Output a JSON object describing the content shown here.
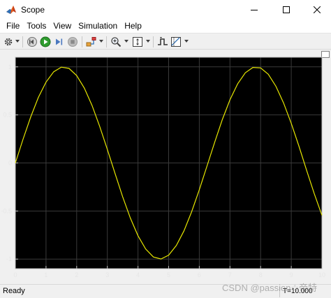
{
  "window": {
    "title": "Scope",
    "controls": [
      "minimize",
      "maximize",
      "close"
    ]
  },
  "menu": [
    "File",
    "Tools",
    "View",
    "Simulation",
    "Help"
  ],
  "toolbar": {
    "buttons": [
      {
        "icon": "gear-icon",
        "dropdown": true
      },
      {
        "icon": "step-back-icon"
      },
      {
        "icon": "run-icon",
        "color": "#2e9c2e"
      },
      {
        "icon": "step-forward-icon"
      },
      {
        "icon": "stop-icon",
        "disabled": true
      },
      {
        "icon": "highlight-signal-icon",
        "dropdown": true
      },
      {
        "icon": "zoom-in-icon",
        "dropdown": true
      },
      {
        "icon": "autoscale-icon",
        "dropdown": true
      },
      {
        "icon": "triggers-icon"
      },
      {
        "icon": "cursor-measurements-icon",
        "dropdown": true
      }
    ]
  },
  "status": {
    "text": "Ready",
    "time": "T=10.000"
  },
  "watermark": "CSDN @passion☆帝特",
  "colors": {
    "plot_background": "#000000",
    "grid": "#3a3a3a",
    "axes": "#c0c0c0",
    "tick_labels": "#e6e6e6",
    "trace": "#e6e600"
  },
  "chart_data": {
    "type": "line",
    "title": "",
    "xlabel": "",
    "ylabel": "",
    "xlim": [
      0,
      10
    ],
    "ylim": [
      -1.1,
      1.1
    ],
    "xticks": [
      0,
      1,
      2,
      3,
      4,
      5,
      6,
      7,
      8,
      9,
      10
    ],
    "yticks": [
      -1,
      -0.5,
      0,
      0.5,
      1
    ],
    "ytick_labels": [
      "-1",
      "-0.5",
      "0",
      "0.5",
      "1"
    ],
    "grid": true,
    "series": [
      {
        "color": "#e6e600",
        "x": [
          0,
          0.25,
          0.5,
          0.75,
          1,
          1.25,
          1.5,
          1.75,
          2,
          2.25,
          2.5,
          2.75,
          3,
          3.25,
          3.5,
          3.75,
          4,
          4.25,
          4.5,
          4.75,
          5,
          5.25,
          5.5,
          5.75,
          6,
          6.25,
          6.5,
          6.75,
          7,
          7.25,
          7.5,
          7.75,
          8,
          8.25,
          8.5,
          8.75,
          9,
          9.25,
          9.5,
          9.75,
          10
        ],
        "y": [
          0,
          0.247,
          0.479,
          0.682,
          0.841,
          0.949,
          0.997,
          0.984,
          0.909,
          0.778,
          0.598,
          0.382,
          0.141,
          -0.108,
          -0.351,
          -0.572,
          -0.757,
          -0.895,
          -0.978,
          -0.999,
          -0.959,
          -0.859,
          -0.706,
          -0.508,
          -0.279,
          -0.033,
          0.215,
          0.45,
          0.657,
          0.823,
          0.938,
          0.994,
          0.989,
          0.923,
          0.798,
          0.624,
          0.412,
          0.174,
          -0.075,
          -0.319,
          -0.544
        ]
      }
    ]
  }
}
